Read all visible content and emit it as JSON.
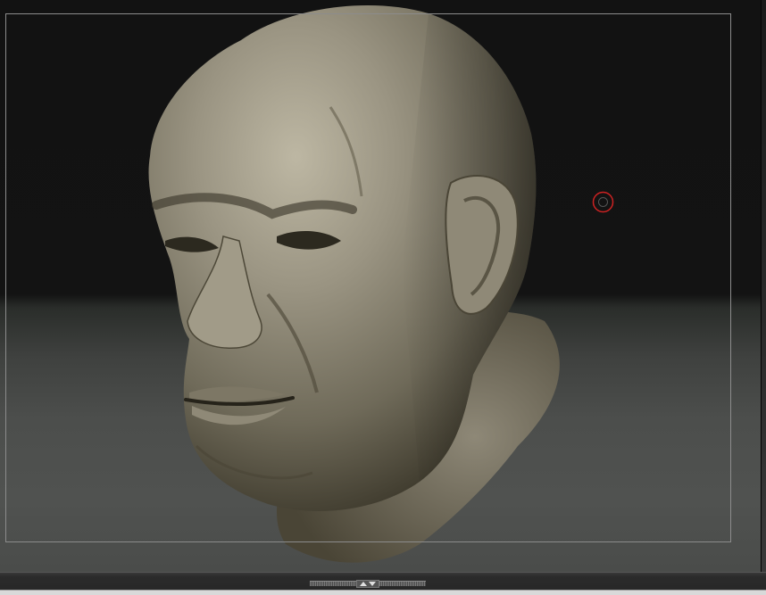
{
  "app": {
    "view": "3d-sculpt-canvas",
    "subject": "sculpted-head-model"
  },
  "canvas": {
    "background_top": "#121212",
    "background_bottom": "#505250",
    "frame_color": "#8c8c8c"
  },
  "model": {
    "material_color": "#8a8472",
    "highlight_color": "#bdb7a3",
    "shadow_color": "#3a3629"
  },
  "brush_cursor": {
    "color": "#cc2222",
    "icon": "brush-circle-cursor"
  },
  "tray": {
    "handle_icon": "up-down-arrows-icon"
  }
}
